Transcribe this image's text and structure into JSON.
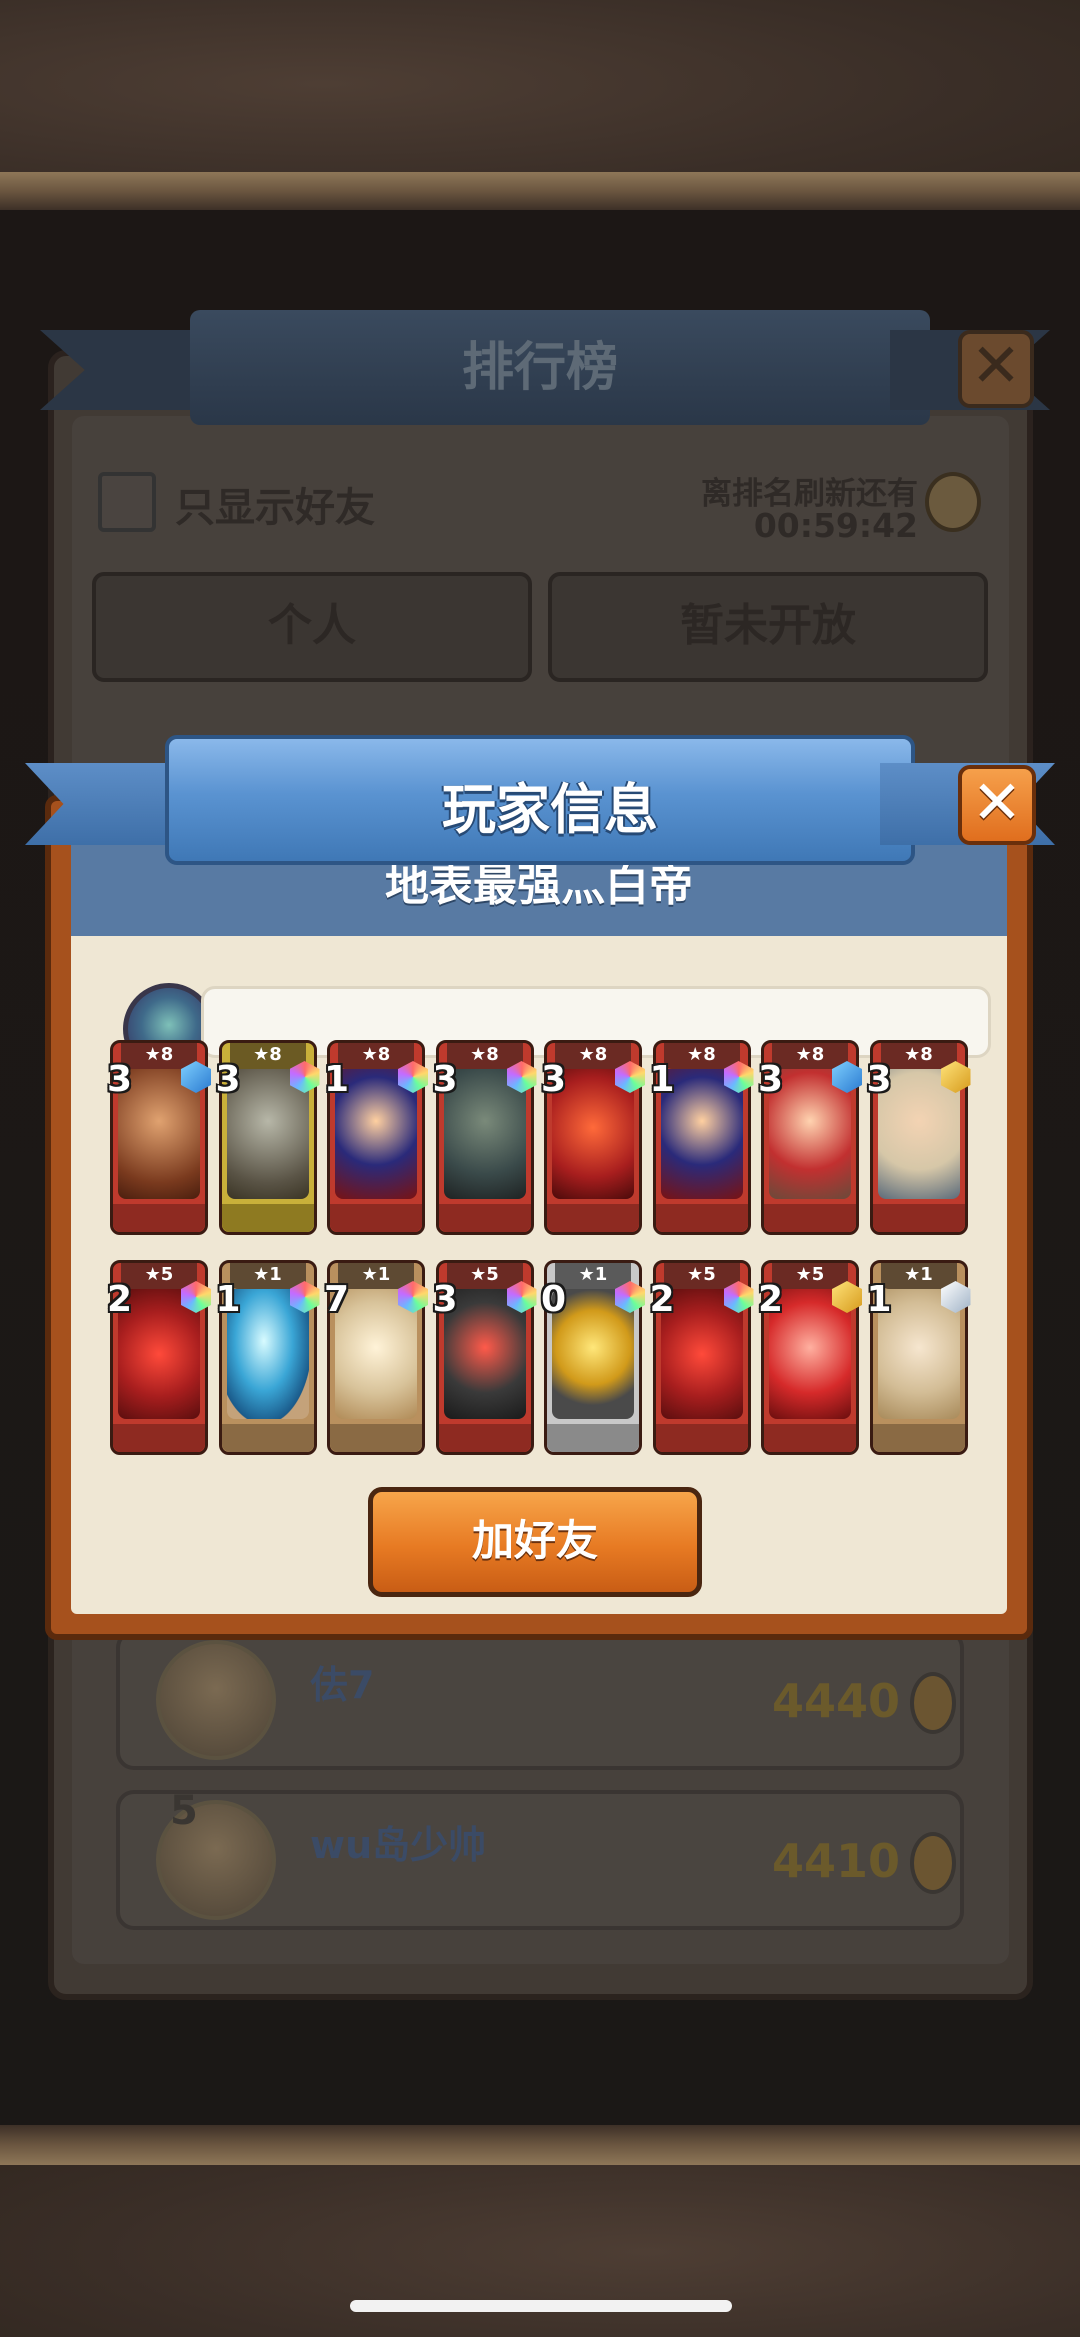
{
  "background_ranking": {
    "title": "排行榜",
    "close_label": "✕",
    "filter_label": "只显示好友",
    "refresh_label": "离排名刷新还有",
    "refresh_timer": "00:59:42",
    "tabs": [
      "个人",
      "暂未开放"
    ],
    "rows": [
      {
        "rank": "",
        "name": "佉7",
        "score": "4440"
      },
      {
        "rank": "5",
        "name": "wu岛少帅",
        "score": "4410"
      }
    ]
  },
  "player_info": {
    "title": "玩家信息",
    "close_label": "✕",
    "player_name": "地表最强灬白帝",
    "status_text": "",
    "add_friend_label": "加好友"
  },
  "hero_cards": [
    {
      "stars": "★8",
      "level": "3",
      "frame": "red",
      "gem": "blue",
      "art": "warrior-bronze"
    },
    {
      "stars": "★8",
      "level": "3",
      "frame": "yellow",
      "gem": "rainbow",
      "art": "wolf-archer"
    },
    {
      "stars": "★8",
      "level": "1",
      "frame": "red",
      "gem": "rainbow",
      "art": "red-mage"
    },
    {
      "stars": "★8",
      "level": "3",
      "frame": "red",
      "gem": "rainbow",
      "art": "dark-knight"
    },
    {
      "stars": "★8",
      "level": "3",
      "frame": "red",
      "gem": "rainbow",
      "art": "red-dragon"
    },
    {
      "stars": "★8",
      "level": "1",
      "frame": "red",
      "gem": "rainbow",
      "art": "red-mage"
    },
    {
      "stars": "★8",
      "level": "3",
      "frame": "red",
      "gem": "blue",
      "art": "red-riding-hood"
    },
    {
      "stars": "★8",
      "level": "3",
      "frame": "red",
      "gem": "gold",
      "art": "old-priest"
    }
  ],
  "item_cards": [
    {
      "stars": "★5",
      "level": "2",
      "frame": "red",
      "gem": "rainbow",
      "art": "boots"
    },
    {
      "stars": "★1",
      "level": "1",
      "frame": "tan",
      "gem": "rainbow",
      "art": "egg"
    },
    {
      "stars": "★1",
      "level": "7",
      "frame": "tan",
      "gem": "rainbow",
      "art": "scales"
    },
    {
      "stars": "★5",
      "level": "3",
      "frame": "red",
      "gem": "rainbow",
      "art": "armor"
    },
    {
      "stars": "★1",
      "level": "0",
      "frame": "silver",
      "gem": "rainbow",
      "art": "gold-coin"
    },
    {
      "stars": "★5",
      "level": "2",
      "frame": "red",
      "gem": "rainbow",
      "art": "boots"
    },
    {
      "stars": "★5",
      "level": "2",
      "frame": "red",
      "gem": "gold",
      "art": "staff"
    },
    {
      "stars": "★1",
      "level": "1",
      "frame": "tan",
      "gem": "silver",
      "art": "hammer"
    }
  ],
  "colors": {
    "accent_blue": "#5a93d1",
    "button_orange": "#e77a23",
    "panel_frame": "#a6511d",
    "paper": "#efe7d4"
  }
}
